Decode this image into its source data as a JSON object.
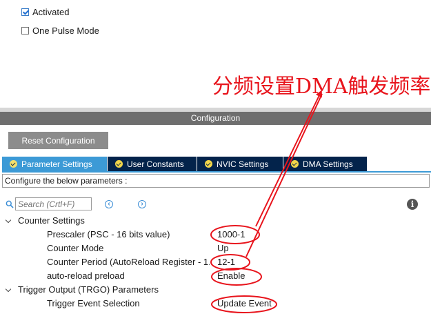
{
  "mode_options": [
    {
      "label": "Activated",
      "checked": true
    },
    {
      "label": "One Pulse Mode",
      "checked": false
    }
  ],
  "annotation": {
    "text": "分频设置DMA触发频率",
    "color": "#e8141c"
  },
  "configuration": {
    "header": "Configuration",
    "reset_label": "Reset Configuration",
    "tabs": [
      {
        "label": "Parameter Settings",
        "active": true
      },
      {
        "label": "User Constants",
        "active": false
      },
      {
        "label": "NVIC Settings",
        "active": false
      },
      {
        "label": "DMA Settings",
        "active": false
      }
    ],
    "info_text": "Configure the below parameters :",
    "search_placeholder": "Search (Crtl+F)",
    "groups": [
      {
        "label": "Counter Settings",
        "params": [
          {
            "label": "Prescaler (PSC - 16 bits value)",
            "value": "1000-1"
          },
          {
            "label": "Counter Mode",
            "value": "Up"
          },
          {
            "label": "Counter Period (AutoReload Register - 1...",
            "value": "12-1"
          },
          {
            "label": "auto-reload preload",
            "value": "Enable"
          }
        ]
      },
      {
        "label": "Trigger Output (TRGO) Parameters",
        "params": [
          {
            "label": "Trigger Event Selection",
            "value": "Update Event"
          }
        ]
      }
    ]
  },
  "colors": {
    "active_tab": "#3c9ad6",
    "tab_bg": "#03234b",
    "header_bg": "#6e6e6e",
    "reset_bg": "#8c8c8c",
    "annotation_red": "#e8141c"
  }
}
